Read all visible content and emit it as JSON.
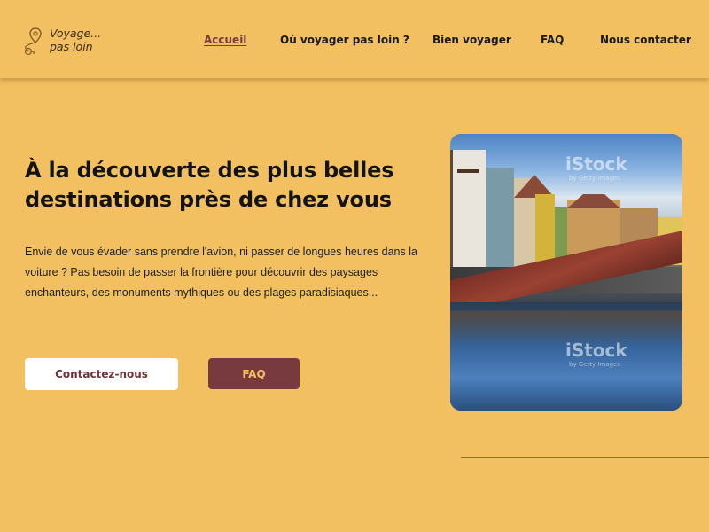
{
  "logo": {
    "line1": "Voyage...",
    "line2": "pas loin"
  },
  "nav": {
    "items": [
      {
        "label": "Accueil",
        "active": true
      },
      {
        "label": "Où voyager pas loin ?",
        "active": false
      },
      {
        "label": "Bien voyager",
        "active": false
      },
      {
        "label": "FAQ",
        "active": false
      },
      {
        "label": "Nous contacter",
        "active": false
      }
    ]
  },
  "hero": {
    "title": "À la découverte des plus belles destinations près de chez vous",
    "text": "Envie de vous évader sans prendre l'avion, ni passer de longues heures dans la voiture ? Pas besoin de passer la frontière pour découvrir des paysages enchanteurs, des monuments mythiques ou des plages paradisiaques...",
    "primary_button": "Contactez-nous",
    "secondary_button": "FAQ"
  },
  "photo": {
    "watermark_brand": "iStock",
    "watermark_credit": "by Getty Images"
  },
  "colors": {
    "background": "#f2c061",
    "accent": "#793a3f",
    "active_link": "#7a3b3f",
    "button_light": "#ffffff"
  }
}
